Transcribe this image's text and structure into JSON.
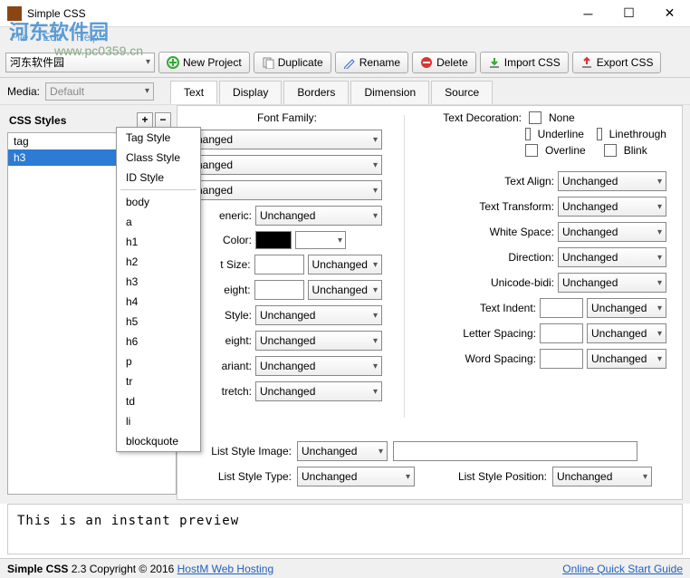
{
  "window": {
    "title": "Simple CSS"
  },
  "watermark": {
    "logo": "河东软件园",
    "url": "www.pc0359.cn"
  },
  "menu": {
    "file": "File",
    "edit": "Edit",
    "help": "Help"
  },
  "toolbar": {
    "project_selected": "河东软件园",
    "new": "New Project",
    "duplicate": "Duplicate",
    "rename": "Rename",
    "delete": "Delete",
    "import": "Import CSS",
    "export": "Export CSS"
  },
  "media": {
    "label": "Media:",
    "value": "Default"
  },
  "tabs": {
    "text": "Text",
    "display": "Display",
    "borders": "Borders",
    "dimension": "Dimension",
    "source": "Source"
  },
  "sidebar": {
    "title": "CSS Styles",
    "plus": "+",
    "minus": "−",
    "items": [
      "tag",
      "h3"
    ]
  },
  "context_menu": {
    "tag_style": "Tag Style",
    "class_style": "Class Style",
    "id_style": "ID Style",
    "tags": [
      "body",
      "a",
      "h1",
      "h2",
      "h3",
      "h4",
      "h5",
      "h6",
      "p",
      "tr",
      "td",
      "li",
      "blockquote"
    ]
  },
  "font": {
    "header": "Font Family:",
    "sel1": "nanged",
    "sel2": "nanged",
    "sel3": "nanged",
    "generic_label": "eneric:",
    "generic": "Unchanged",
    "color_label": "Color:",
    "size_label": "t Size:",
    "size_unit": "Unchanged",
    "height_label": "eight:",
    "height_unit": "Unchanged",
    "style_label": "Style:",
    "style": "Unchanged",
    "weight_label": "eight:",
    "weight": "Unchanged",
    "variant_label": "ariant:",
    "variant": "Unchanged",
    "stretch_label": "tretch:",
    "stretch": "Unchanged"
  },
  "deco": {
    "label": "Text Decoration:",
    "none": "None",
    "underline": "Underline",
    "linethrough": "Linethrough",
    "overline": "Overline",
    "blink": "Blink"
  },
  "right": {
    "align_label": "Text Align:",
    "align": "Unchanged",
    "transform_label": "Text Transform:",
    "transform": "Unchanged",
    "whitespace_label": "White Space:",
    "whitespace": "Unchanged",
    "direction_label": "Direction:",
    "direction": "Unchanged",
    "bidi_label": "Unicode-bidi:",
    "bidi": "Unchanged",
    "indent_label": "Text Indent:",
    "indent_unit": "Unchanged",
    "letter_label": "Letter Spacing:",
    "letter_unit": "Unchanged",
    "word_label": "Word Spacing:",
    "word_unit": "Unchanged"
  },
  "list": {
    "image_label": "List Style Image:",
    "image": "Unchanged",
    "type_label": "List Style Type:",
    "type": "Unchanged",
    "pos_label": "List Style Position:",
    "pos": "Unchanged"
  },
  "preview": {
    "text": "This is an instant preview"
  },
  "status": {
    "app": "Simple CSS",
    "ver": "2.3",
    "copy": "Copyright © 2016",
    "host": "HostM Web Hosting",
    "guide": "Online Quick Start Guide"
  }
}
